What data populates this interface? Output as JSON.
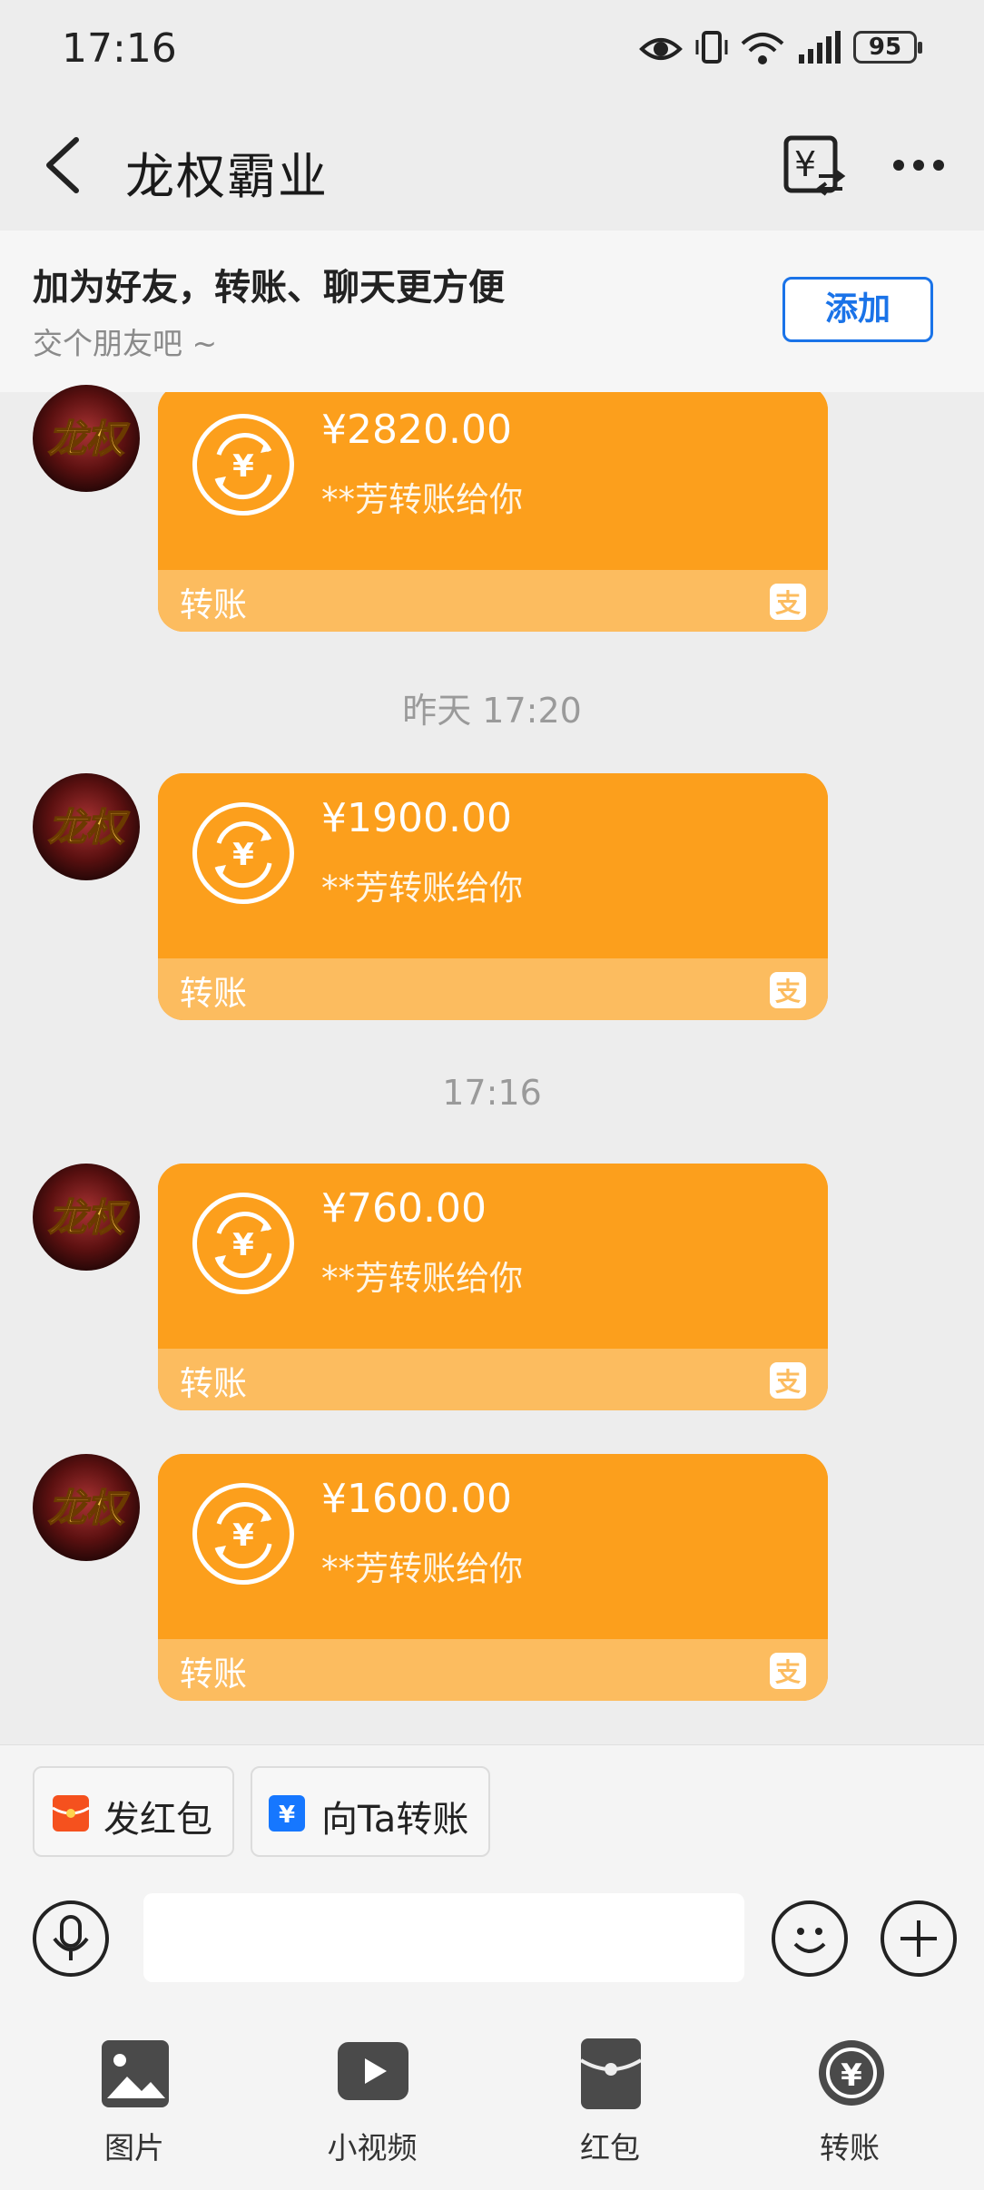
{
  "status_bar": {
    "time": "17:16",
    "battery": "95"
  },
  "header": {
    "title": "龙权霸业"
  },
  "banner": {
    "title": "加为好友，转账、聊天更方便",
    "subtitle": "交个朋友吧 ~",
    "add_label": "添加"
  },
  "messages": [
    {
      "amount": "¥2820.00",
      "from": "**芳转账给你",
      "label": "转账"
    },
    {
      "amount": "¥1900.00",
      "from": "**芳转账给你",
      "label": "转账"
    },
    {
      "amount": "¥760.00",
      "from": "**芳转账给你",
      "label": "转账"
    },
    {
      "amount": "¥1600.00",
      "from": "**芳转账给你",
      "label": "转账"
    }
  ],
  "timestamps": [
    "昨天 17:20",
    "17:16"
  ],
  "avatar_text": "龙权",
  "quick_actions": {
    "red_packet": "发红包",
    "transfer_to": "向Ta转账"
  },
  "toolbar": {
    "image": "图片",
    "video": "小视频",
    "red_packet": "红包",
    "transfer": "转账"
  },
  "colors": {
    "card": "#fc9f1c",
    "card_footer": "#fcbc5f",
    "accent": "#1a73e8"
  }
}
